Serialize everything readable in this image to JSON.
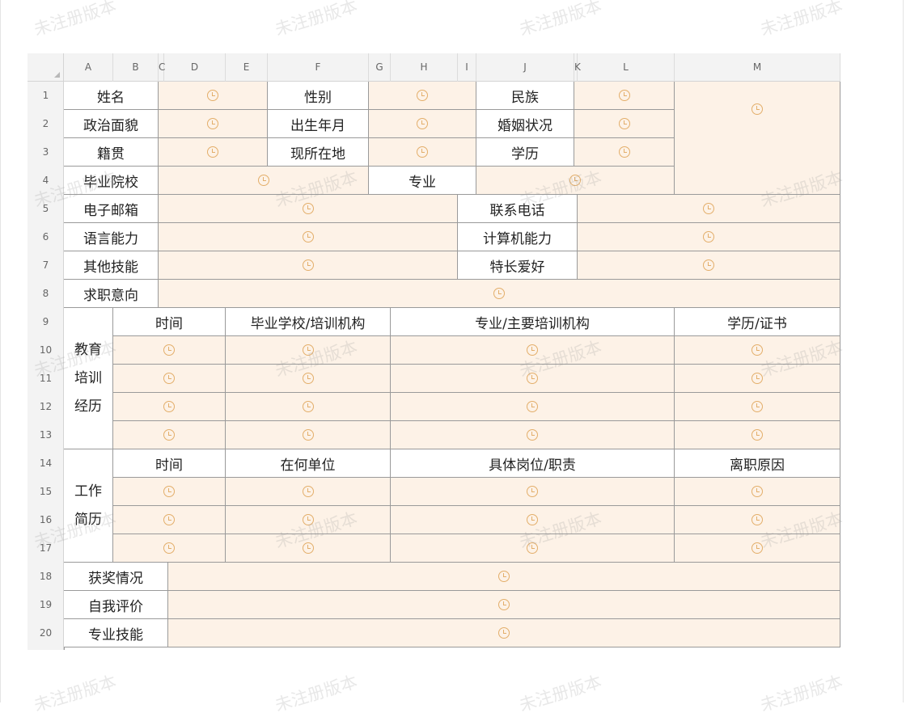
{
  "spreadsheet": {
    "columns": [
      "A",
      "B",
      "C",
      "D",
      "E",
      "F",
      "G",
      "H",
      "I",
      "J",
      "K",
      "L",
      "M"
    ],
    "rows": [
      "1",
      "2",
      "3",
      "4",
      "5",
      "6",
      "7",
      "8",
      "9",
      "10",
      "11",
      "12",
      "13",
      "14",
      "15",
      "16",
      "17",
      "18",
      "19",
      "20"
    ]
  },
  "form": {
    "name": "姓名",
    "gender": "性别",
    "ethnicity": "民族",
    "political_status": "政治面貌",
    "birth_date": "出生年月",
    "marital_status": "婚姻状况",
    "native_place": "籍贯",
    "current_location": "现所在地",
    "education_level": "学历",
    "graduated_school": "毕业院校",
    "major": "专业",
    "email": "电子邮箱",
    "phone": "联系电话",
    "language_ability": "语言能力",
    "computer_ability": "计算机能力",
    "other_skills": "其他技能",
    "specialty_hobbies": "特长爱好",
    "job_intention": "求职意向",
    "edu_section": [
      "教育",
      "培训",
      "经历"
    ],
    "edu_headers": [
      "时间",
      "毕业学校/培训机构",
      "专业/主要培训机构",
      "学历/证书"
    ],
    "work_section": [
      "工作",
      "简历"
    ],
    "work_headers": [
      "时间",
      "在何单位",
      "具体岗位/职责",
      "离职原因"
    ],
    "awards": "获奖情况",
    "self_evaluation": "自我评价",
    "professional_skills": "专业技能"
  },
  "watermark": "未注册版本",
  "icons": {
    "input_placeholder": "clock-icon"
  },
  "colors": {
    "input_fill": "#fdf2e7",
    "icon": "#e3ae6a",
    "grid": "#9a9a9a",
    "header_bg": "#f3f3f3"
  }
}
